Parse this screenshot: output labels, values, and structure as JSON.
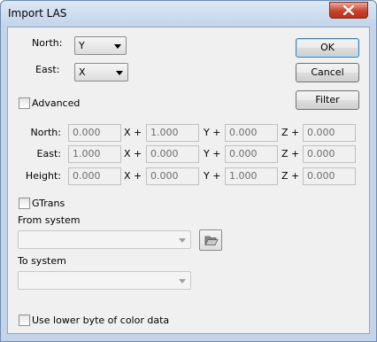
{
  "window": {
    "title": "Import LAS"
  },
  "north_label": "North:",
  "east_label": "East:",
  "north_select": {
    "value": "Y"
  },
  "east_select": {
    "value": "X"
  },
  "buttons": {
    "ok": "OK",
    "cancel": "Cancel",
    "filter": "Filter"
  },
  "advanced": {
    "label": "Advanced",
    "checked": false
  },
  "matrix": {
    "rows": [
      {
        "label": "North:",
        "values": [
          "0.000",
          "1.000",
          "0.000",
          "0.000"
        ]
      },
      {
        "label": "East:",
        "values": [
          "1.000",
          "0.000",
          "0.000",
          "0.000"
        ]
      },
      {
        "label": "Height:",
        "values": [
          "0.000",
          "0.000",
          "1.000",
          "0.000"
        ]
      }
    ],
    "ops": [
      "X +",
      "Y +",
      "Z +"
    ]
  },
  "gtrans": {
    "label": "GTrans",
    "checked": false
  },
  "from_system": {
    "label": "From system",
    "value": ""
  },
  "to_system": {
    "label": "To system",
    "value": ""
  },
  "lower_byte": {
    "label": "Use lower byte of color data",
    "checked": false
  },
  "icons": {
    "close": "close-icon",
    "browse": "folder-open-icon"
  }
}
